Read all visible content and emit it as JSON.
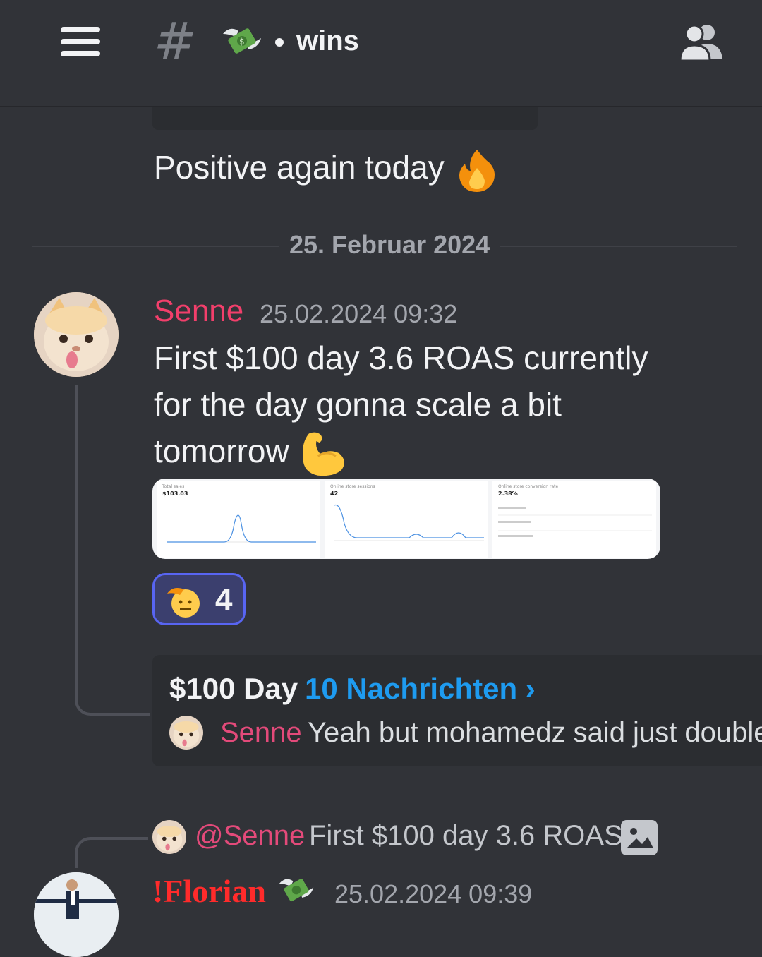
{
  "header": {
    "channel_prefix": "#",
    "channel_emoji": "money-with-wings",
    "channel_name": "wins",
    "icons": [
      "menu-icon",
      "members-icon"
    ]
  },
  "previous_message": {
    "text": "Positive again today",
    "emoji": "fire"
  },
  "date_divider": "25. Februar 2024",
  "message": {
    "author": "Senne",
    "author_color": "#f23f6b",
    "timestamp": "25.02.2024 09:32",
    "lines": [
      "First $100 day 3.6 ROAS currently",
      "for the day gonna scale a bit",
      "tomorrow"
    ],
    "emoji": "flexed-biceps",
    "attachment": {
      "panels": [
        {
          "label": "Total sales",
          "value": "$103.03"
        },
        {
          "label": "Online store sessions",
          "value": "42"
        },
        {
          "label": "Online store conversion rate",
          "value": "2.38%"
        }
      ]
    },
    "reaction": {
      "emoji": "saluting-face",
      "count": "4"
    }
  },
  "thread": {
    "title": "$100 Day",
    "count_label": "10 Nachrichten ›",
    "last_author": "Senne",
    "last_text": "Yeah but mohamedz said just double"
  },
  "next_message": {
    "reply_mention": "@Senne",
    "reply_text": "First $100 day 3.6 ROAS",
    "author": "!Florian",
    "author_color": "#ff2b2b",
    "timestamp": "25.02.2024 09:39"
  }
}
